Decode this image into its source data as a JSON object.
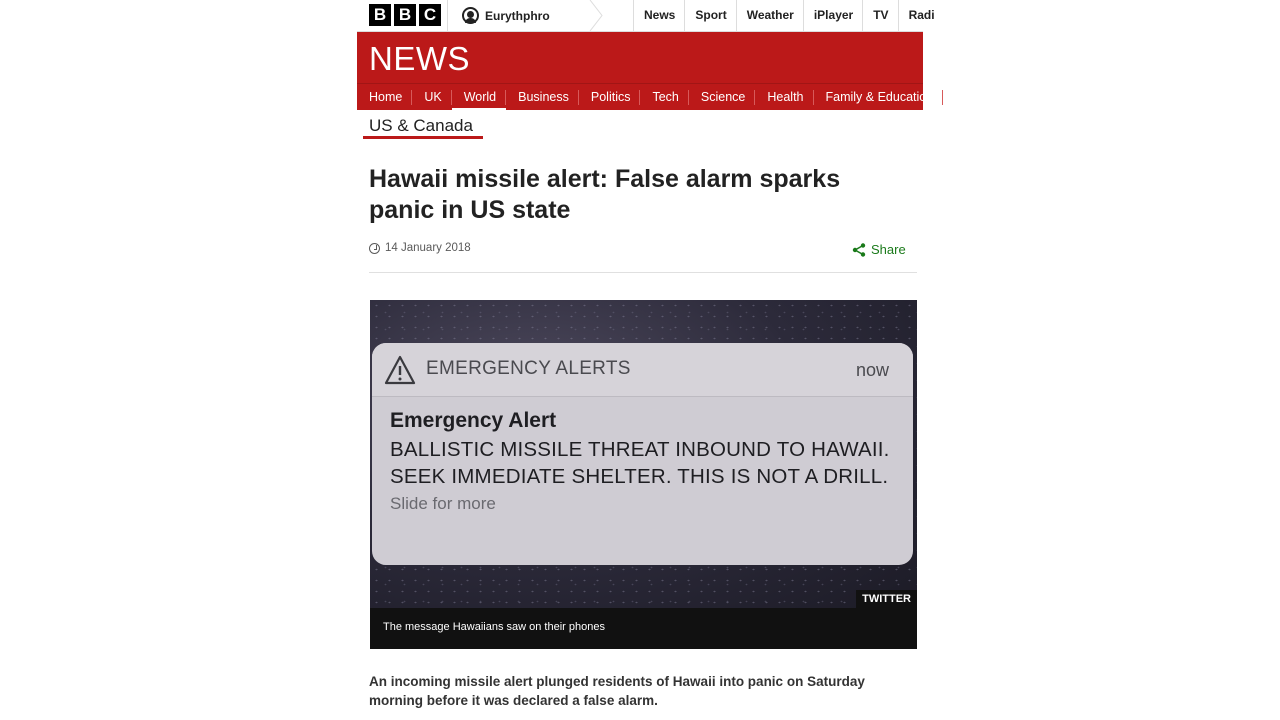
{
  "brand": {
    "letters": [
      "B",
      "B",
      "C"
    ]
  },
  "account": {
    "name": "Eurythphro"
  },
  "top_nav": [
    "News",
    "Sport",
    "Weather",
    "iPlayer",
    "TV",
    "Radi"
  ],
  "header": {
    "title": "NEWS",
    "nav": [
      "Home",
      "UK",
      "World",
      "Business",
      "Politics",
      "Tech",
      "Science",
      "Health",
      "Family & Education"
    ],
    "active": "World"
  },
  "section": "US & Canada",
  "article": {
    "headline": "Hawaii missile alert: False alarm sparks panic in US state",
    "date": "14 January 2018",
    "share_label": "Share",
    "image": {
      "source_label": "EMERGENCY ALERTS",
      "time_label": "now",
      "alert_title": "Emergency Alert",
      "alert_message": "BALLISTIC MISSILE THREAT INBOUND TO HAWAII. SEEK IMMEDIATE SHELTER. THIS IS NOT A DRILL.",
      "more_label": "Slide for more",
      "credit": "TWITTER",
      "caption": "The message Hawaiians saw on their phones"
    },
    "intro": "An incoming missile alert plunged residents of Hawaii into panic on Saturday morning before it was declared a false alarm."
  },
  "colors": {
    "brand_red": "#bb1919",
    "share_green": "#1a7a1a"
  }
}
